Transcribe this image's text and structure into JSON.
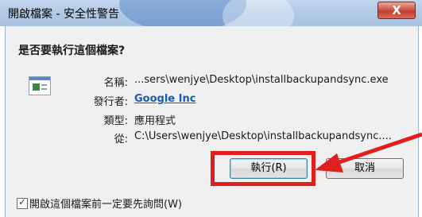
{
  "window": {
    "title": "開啟檔案 - 安全性警告",
    "close_glyph": "X"
  },
  "prompt": {
    "question": "是否要執行這個檔案?"
  },
  "file_info": {
    "icon": "application-file-icon",
    "name_label": "名稱:",
    "name_value": "...sers\\wenjye\\Desktop\\installbackupandsync.exe",
    "publisher_label": "發行者:",
    "publisher_value": "Google Inc",
    "type_label": "類型:",
    "type_value": "應用程式",
    "from_label": "從:",
    "from_value": "C:\\Users\\wenjye\\Desktop\\installbackupandsync...."
  },
  "buttons": {
    "run_label": "執行(R)",
    "cancel_label": "取消"
  },
  "checkbox": {
    "checked": true,
    "label": "開啟這個檔案前一定要先詢問(W)"
  },
  "annotation": {
    "color": "#e01f1f"
  }
}
